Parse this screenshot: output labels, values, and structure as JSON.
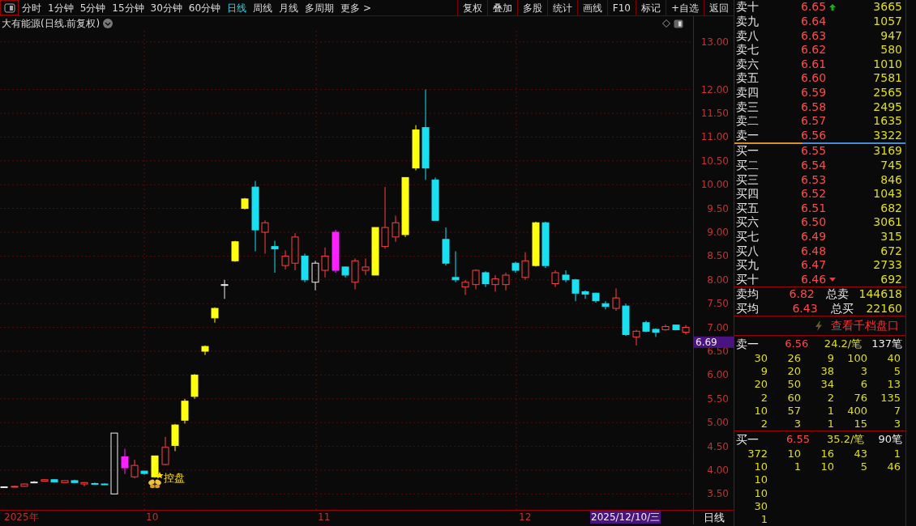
{
  "toolbar": {
    "periods": [
      {
        "label": "分时",
        "selected": false
      },
      {
        "label": "1分钟",
        "selected": false
      },
      {
        "label": "5分钟",
        "selected": false
      },
      {
        "label": "15分钟",
        "selected": false
      },
      {
        "label": "30分钟",
        "selected": false
      },
      {
        "label": "60分钟",
        "selected": false
      },
      {
        "label": "日线",
        "selected": true
      },
      {
        "label": "周线",
        "selected": false
      },
      {
        "label": "月线",
        "selected": false
      },
      {
        "label": "多周期",
        "selected": false
      }
    ],
    "more": "更多 >",
    "buttons": [
      "复权",
      "叠加",
      "多股",
      "统计",
      "画线",
      "F10",
      "标记",
      "+自选",
      "返回"
    ]
  },
  "chart": {
    "title": "大有能源(日线.前复权)",
    "price_ticks": [
      "13.00",
      "12.00",
      "11.50",
      "11.00",
      "10.50",
      "10.00",
      "9.50",
      "9.00",
      "8.50",
      "8.00",
      "7.50",
      "7.00",
      "6.50",
      "6.00",
      "5.50",
      "5.00",
      "4.50",
      "4.00",
      "3.50"
    ],
    "current_price": "6.69",
    "marker_label": "控盘",
    "x_labels": [
      "2025年",
      "10",
      "11",
      "12"
    ],
    "cursor_date": "2025/12/10/三",
    "period_label": "日线"
  },
  "order_book": {
    "asks": [
      {
        "label": "卖十",
        "price": "6.65",
        "volume": "3665",
        "rising": true
      },
      {
        "label": "卖九",
        "price": "6.64",
        "volume": "1057"
      },
      {
        "label": "卖八",
        "price": "6.63",
        "volume": "947"
      },
      {
        "label": "卖七",
        "price": "6.62",
        "volume": "580"
      },
      {
        "label": "卖六",
        "price": "6.61",
        "volume": "1010"
      },
      {
        "label": "卖五",
        "price": "6.60",
        "volume": "7581"
      },
      {
        "label": "卖四",
        "price": "6.59",
        "volume": "2565"
      },
      {
        "label": "卖三",
        "price": "6.58",
        "volume": "2495"
      },
      {
        "label": "卖二",
        "price": "6.57",
        "volume": "1635"
      },
      {
        "label": "卖一",
        "price": "6.56",
        "volume": "3322"
      }
    ],
    "bids": [
      {
        "label": "买一",
        "price": "6.55",
        "volume": "3169"
      },
      {
        "label": "买二",
        "price": "6.54",
        "volume": "745"
      },
      {
        "label": "买三",
        "price": "6.53",
        "volume": "846"
      },
      {
        "label": "买四",
        "price": "6.52",
        "volume": "1043"
      },
      {
        "label": "买五",
        "price": "6.51",
        "volume": "682"
      },
      {
        "label": "买六",
        "price": "6.50",
        "volume": "3061"
      },
      {
        "label": "买七",
        "price": "6.49",
        "volume": "315"
      },
      {
        "label": "买八",
        "price": "6.48",
        "volume": "672"
      },
      {
        "label": "买九",
        "price": "6.47",
        "volume": "2733"
      },
      {
        "label": "买十",
        "price": "6.46",
        "volume": "692",
        "falling": true
      }
    ],
    "summary": [
      {
        "label": "卖均",
        "price": "6.82",
        "total_label": "总卖",
        "total": "144618"
      },
      {
        "label": "买均",
        "price": "6.43",
        "total_label": "总买",
        "total": "22160"
      }
    ],
    "depth_link": "查看千档盘口",
    "queues": [
      {
        "label": "卖一",
        "price": "6.56",
        "average": "24.2/笔",
        "count": "137笔",
        "orders": [
          [
            "30",
            "26",
            "9",
            "100",
            "40"
          ],
          [
            "9",
            "20",
            "38",
            "3",
            "5"
          ],
          [
            "20",
            "50",
            "34",
            "6",
            "13"
          ],
          [
            "2",
            "60",
            "2",
            "76",
            "135"
          ],
          [
            "10",
            "57",
            "1",
            "400",
            "7"
          ],
          [
            "2",
            "3",
            "1",
            "15",
            "3"
          ]
        ]
      },
      {
        "label": "买一",
        "price": "6.55",
        "average": "35.2/笔",
        "count": "90笔",
        "orders": [
          [
            "372",
            "10",
            "16",
            "43",
            "1"
          ],
          [
            "10",
            "1",
            "10",
            "5",
            "46"
          ],
          [
            "10"
          ],
          [
            "10"
          ],
          [
            "30"
          ],
          [
            "1"
          ]
        ]
      }
    ]
  }
}
